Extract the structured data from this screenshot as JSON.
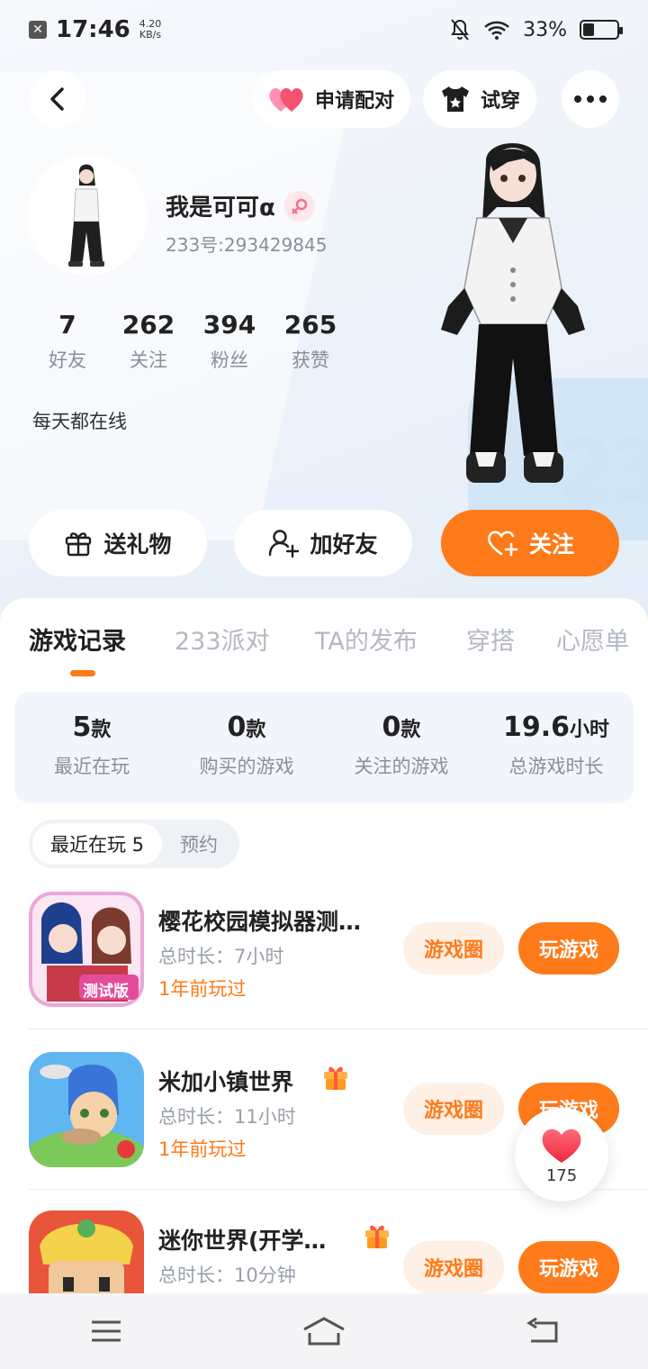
{
  "status_bar": {
    "time": "17:46",
    "speed_value": "4.20",
    "speed_unit": "KB/s",
    "battery_pct": "33%",
    "battery_level": 0.33
  },
  "header": {
    "pair_label": "申请配对",
    "tryon_label": "试穿"
  },
  "profile": {
    "nickname": "我是可可α",
    "uid": "233号:293429845",
    "bio": "每天都在线",
    "stats": [
      {
        "value": "7",
        "label": "好友"
      },
      {
        "value": "262",
        "label": "关注"
      },
      {
        "value": "394",
        "label": "粉丝"
      },
      {
        "value": "265",
        "label": "获赞"
      }
    ]
  },
  "actions": {
    "gift_label": "送礼物",
    "add_friend_label": "加好友",
    "follow_label": "关注"
  },
  "tabs": [
    "游戏记录",
    "233派对",
    "TA的发布",
    "穿搭",
    "心愿单"
  ],
  "summary": [
    {
      "num": "5",
      "unit": "款",
      "label": "最近在玩"
    },
    {
      "num": "0",
      "unit": "款",
      "label": "购买的游戏"
    },
    {
      "num": "0",
      "unit": "款",
      "label": "关注的游戏"
    },
    {
      "num": "19.6",
      "unit": "小时",
      "label": "总游戏时长"
    }
  ],
  "subtabs": [
    "最近在玩 5",
    "预约"
  ],
  "games": [
    {
      "name": "樱花校园模拟器测…",
      "duration": "总时长：7小时",
      "last_played": "1年前玩过",
      "circle_label": "游戏圈",
      "play_label": "玩游戏",
      "has_gift": false,
      "icon_badge": "测试版"
    },
    {
      "name": "米加小镇世界",
      "duration": "总时长：11小时",
      "last_played": "1年前玩过",
      "circle_label": "游戏圈",
      "play_label": "玩游戏",
      "has_gift": true
    },
    {
      "name": "迷你世界(开学…",
      "duration": "总时长：10分钟",
      "last_played": "",
      "circle_label": "游戏圈",
      "play_label": "玩游戏",
      "has_gift": true
    }
  ],
  "like_float": {
    "count": "175"
  },
  "colors": {
    "accent": "#ff7a1a",
    "accent_light": "#fff0e6",
    "gray_text": "#8a8f99"
  }
}
